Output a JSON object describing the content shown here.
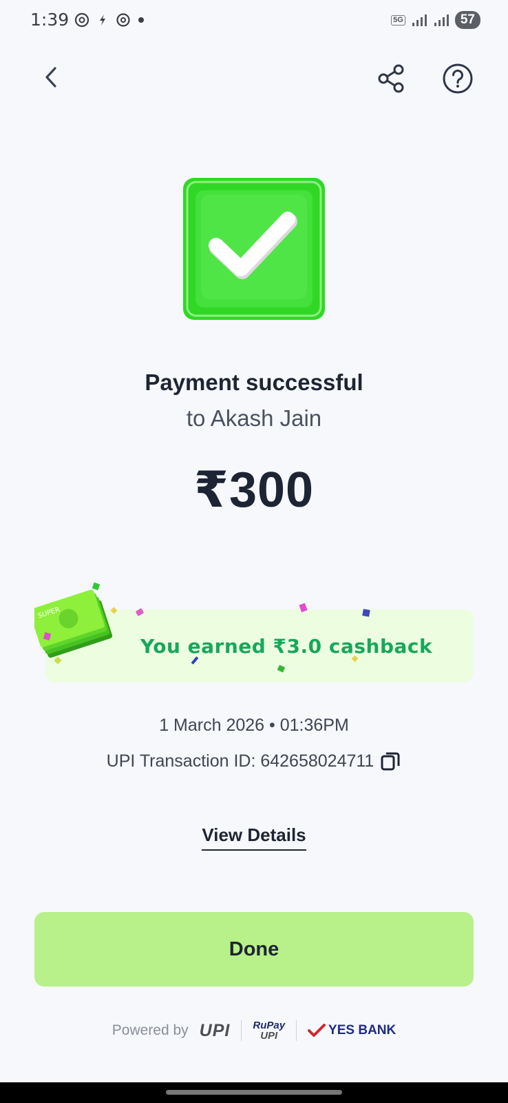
{
  "status_bar": {
    "time": "1:39",
    "battery": "57",
    "network": "5G"
  },
  "header": {
    "back_icon": "chevron-left-icon",
    "share_icon": "share-icon",
    "help_icon": "help-circle-icon"
  },
  "payment": {
    "title": "Payment successful",
    "recipient": "to Akash Jain",
    "amount": "₹300"
  },
  "cashback": {
    "text": "You earned ₹3.0 cashback",
    "money_label": "SUPER"
  },
  "transaction": {
    "datetime": "1 March 2026 • 01:36PM",
    "upi_id": "UPI Transaction ID: 642658024711"
  },
  "actions": {
    "view_details": "View Details",
    "done": "Done"
  },
  "footer": {
    "powered_by": "Powered by",
    "upi_logo": "UPI",
    "rupay_top": "RuPay",
    "rupay_bottom": "UPI",
    "bank": "YES BANK"
  },
  "colors": {
    "success_green": "#3ddc2e",
    "cashback_text": "#17a85a",
    "done_button": "#b8f08a",
    "cashback_bg": "#edfde0"
  }
}
